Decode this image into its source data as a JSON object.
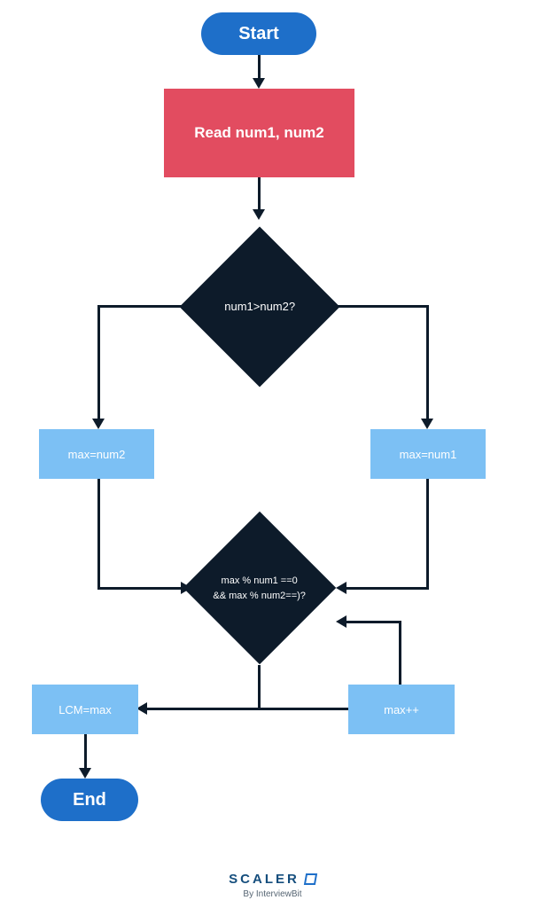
{
  "start": {
    "label": "Start"
  },
  "read": {
    "label": "Read num1, num2"
  },
  "decision1": {
    "label": "num1>num2?"
  },
  "maxNum2": {
    "label": "max=num2"
  },
  "maxNum1": {
    "label": "max=num1"
  },
  "decision2": {
    "line1": "max % num1 ==0",
    "line2": "&& max % num2==)?"
  },
  "lcm": {
    "label": "LCM=max"
  },
  "increment": {
    "label": "max++"
  },
  "end": {
    "label": "End"
  },
  "footer": {
    "brand": "SCALER",
    "sub": "By InterviewBit"
  },
  "colors": {
    "terminal": "#1e6fc9",
    "processRed": "#e24c60",
    "processBlue": "#7cc0f4",
    "decision": "#0d1b2a"
  }
}
